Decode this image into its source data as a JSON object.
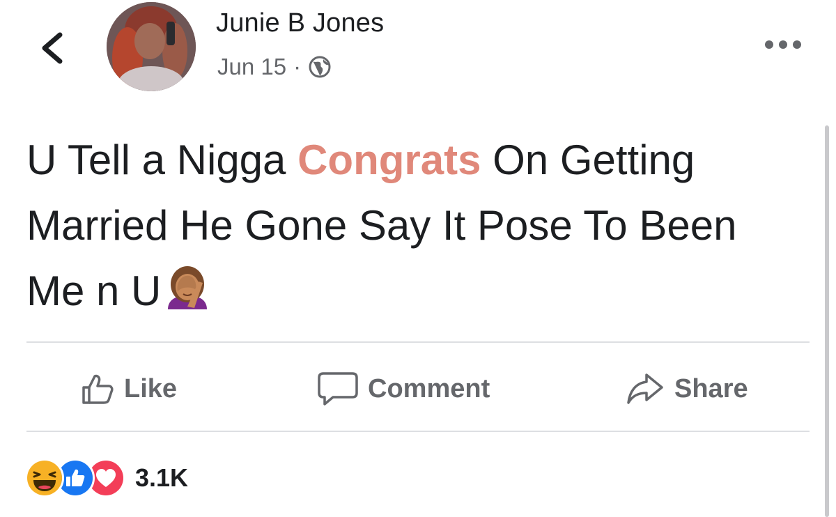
{
  "post": {
    "author_name": "Junie B Jones",
    "date": "Jun 15",
    "separator": "·",
    "privacy_icon": "globe-icon",
    "text_part1": "U Tell a Nigga ",
    "text_highlight": "Congrats",
    "text_part2": " On Getting Married He Gone Say It Pose To Been Me n U",
    "highlight_color": "#e0887a",
    "trailing_emoji": "woman-facepalming-emoji"
  },
  "actions": {
    "like_label": "Like",
    "comment_label": "Comment",
    "share_label": "Share"
  },
  "reactions": {
    "icons": [
      "haha-reaction-icon",
      "like-reaction-icon",
      "love-reaction-icon"
    ],
    "count": "3.1K"
  },
  "colors": {
    "text": "#1c1e21",
    "secondary_text": "#65676b",
    "divider": "#dddfe2",
    "like_blue": "#1877f2",
    "love_red": "#f33e58",
    "haha_yellow": "#f7b125"
  }
}
